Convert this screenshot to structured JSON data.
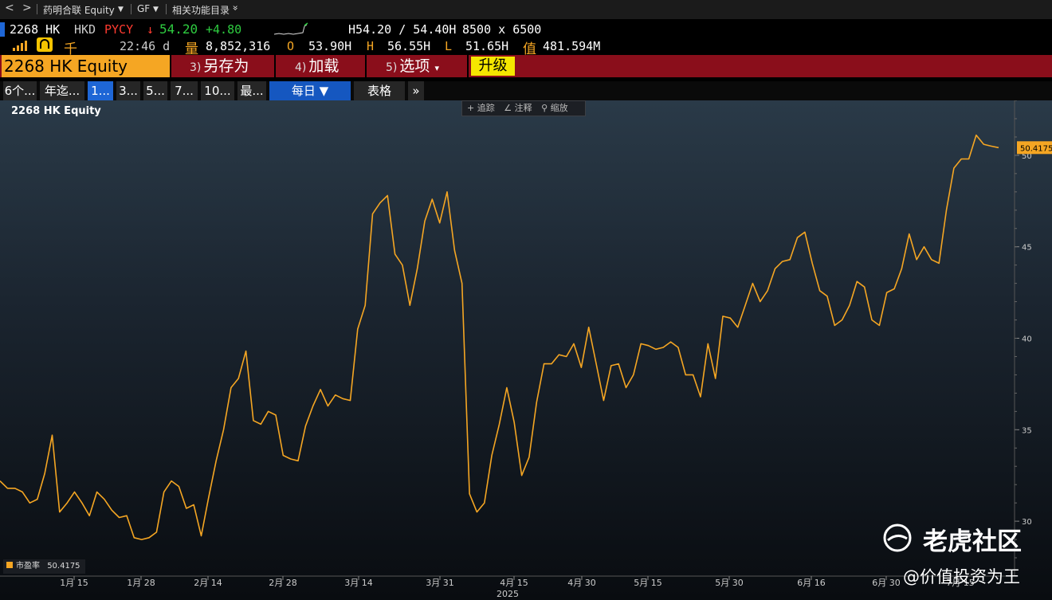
{
  "breadcrumb": {
    "back": "<",
    "forward": ">",
    "security": "药明合联 Equity",
    "dropdown1": "▼",
    "gf": "GF",
    "dropdown2": "▼",
    "related": "相关功能目录",
    "related_chev": "»"
  },
  "quote": {
    "ticker": "2268 HK",
    "currency": "HKD",
    "source": "PYCY",
    "arrow": "↓",
    "last": "54.20",
    "change": "+4.80",
    "bidask": "H54.20 / 54.40H",
    "size": "8500 x 6500",
    "vol_label": "量",
    "volume": "8,852,316",
    "open_label": "O",
    "open": "53.90H",
    "high_label": "H",
    "high": "56.55H",
    "low_label": "L",
    "low": "51.65H",
    "val_label": "值",
    "value": "481.594M",
    "time": "22:46 d",
    "mkt_char": "千"
  },
  "commandbar": {
    "security": "2268 HK Equity",
    "saveas_num": "3)",
    "saveas": "另存为",
    "load_num": "4)",
    "load": "加载",
    "options_num": "5)",
    "options": "选项",
    "options_arrow": "▾",
    "upgrade": "升级"
  },
  "toolbar": {
    "ranges": [
      "6个...",
      "年迄...",
      "1...",
      "3...",
      "5...",
      "7...",
      "10...",
      "最..."
    ],
    "selected_range": "1...",
    "period": "每日 ▼",
    "table": "表格",
    "more": "»"
  },
  "chart_tools": {
    "track": "追踪",
    "annotate": "注释",
    "zoom": "缩放"
  },
  "legend": {
    "label": "市盈率",
    "value": "50.4175"
  },
  "last_value_tag": "50.4175",
  "watermark": {
    "brand": "老虎社区",
    "user": "@价值投资为王"
  },
  "colors": {
    "line": "#f5a623",
    "cmdbar": "#8a0e1b",
    "selected": "#1e66d6",
    "up": "#2ecc40",
    "down": "#ff3b30"
  },
  "chart_data": {
    "type": "line",
    "title": "2268 HK Equity",
    "series": [
      {
        "name": "市盈率",
        "values": [
          32.2,
          31.8,
          31.8,
          31.6,
          31.0,
          31.2,
          32.6,
          34.7,
          30.5,
          31.0,
          31.6,
          31.0,
          30.3,
          31.6,
          31.2,
          30.6,
          30.2,
          30.3,
          29.1,
          29.0,
          29.1,
          29.4,
          31.6,
          32.2,
          31.9,
          30.7,
          30.9,
          29.2,
          31.3,
          33.3,
          35.0,
          37.3,
          37.8,
          39.3,
          35.5,
          35.3,
          36.0,
          35.8,
          33.6,
          33.4,
          33.3,
          35.2,
          36.3,
          37.2,
          36.3,
          36.9,
          36.7,
          36.6,
          40.5,
          41.8,
          46.8,
          47.4,
          47.8,
          44.6,
          44.0,
          41.8,
          43.8,
          46.4,
          47.6,
          46.3,
          48.0,
          44.8,
          43.0,
          31.5,
          30.5,
          31.0,
          33.6,
          35.3,
          37.3,
          35.4,
          32.5,
          33.5,
          36.5,
          38.6,
          38.6,
          39.1,
          39.0,
          39.7,
          38.4,
          40.6,
          38.6,
          36.6,
          38.5,
          38.6,
          37.3,
          38.0,
          39.7,
          39.6,
          39.4,
          39.5,
          39.8,
          39.5,
          38.0,
          38.0,
          36.8,
          39.7,
          37.8,
          41.2,
          41.1,
          40.6,
          41.8,
          43.0,
          42.0,
          42.6,
          43.8,
          44.2,
          44.3,
          45.5,
          45.8,
          44.1,
          42.6,
          42.3,
          40.7,
          41.0,
          41.8,
          43.1,
          42.8,
          41.0,
          40.7,
          42.5,
          42.7,
          43.8,
          45.7,
          44.3,
          45.0,
          44.3,
          44.1,
          47.0,
          49.3,
          49.8,
          49.8,
          51.1,
          50.6,
          50.5,
          50.4175
        ],
        "color": "#f5a623"
      }
    ],
    "x_tick_labels": [
      "1月 15",
      "1月 28",
      "2月 14",
      "2月 28",
      "3月 14",
      "3月 31",
      "4月 15",
      "4月 30",
      "5月 15",
      "5月 30",
      "6月 16",
      "6月 30",
      "7月 15"
    ],
    "year_label": "2025",
    "y_ticks": [
      30,
      35,
      40,
      45,
      50
    ],
    "ylim": [
      27.0,
      53.0
    ],
    "grid": false,
    "legend": "bottom-left"
  }
}
